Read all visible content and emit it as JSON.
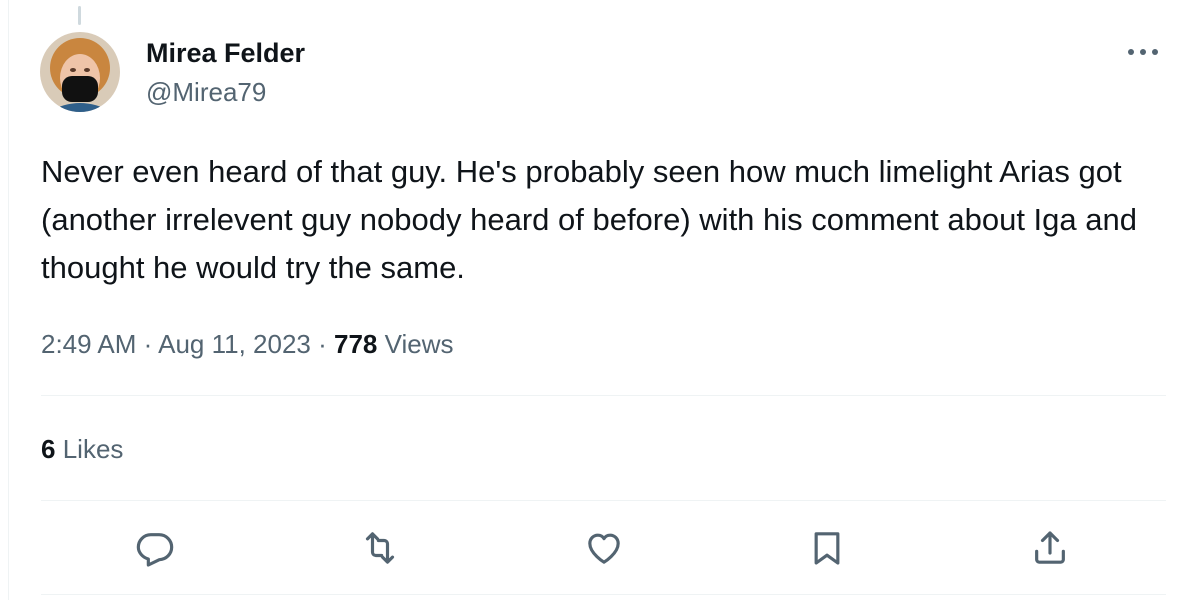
{
  "tweet": {
    "author": {
      "display_name": "Mirea Felder",
      "handle": "@Mirea79"
    },
    "text": "Never even heard of that guy. He's probably seen how much limelight Arias got (another irrelevent guy nobody heard of before) with his comment about Iga and thought he would try the same.",
    "time": "2:49 AM",
    "separator": "·",
    "date": "Aug 11, 2023",
    "views_count": "778",
    "views_label": "Views",
    "likes_count": "6",
    "likes_label": "Likes"
  },
  "icons": {
    "more": "more-horizontal-icon",
    "reply": "reply-bubble-icon",
    "repost": "repost-arrows-icon",
    "like": "heart-icon",
    "bookmark": "bookmark-icon",
    "share": "share-upload-icon"
  },
  "colors": {
    "text_primary": "#0f1419",
    "text_secondary": "#536471",
    "divider": "#eff3f4",
    "icon": "#536471"
  }
}
